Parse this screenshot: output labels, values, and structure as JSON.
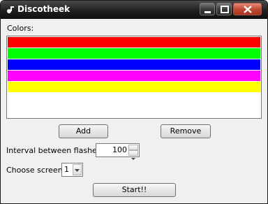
{
  "window": {
    "title": "Discotheek"
  },
  "colors_label": "Colors:",
  "colors": [
    {
      "name": "red",
      "hex": "#ff0000"
    },
    {
      "name": "green",
      "hex": "#00ff00"
    },
    {
      "name": "blue",
      "hex": "#0000ff"
    },
    {
      "name": "magenta",
      "hex": "#ff00ff"
    },
    {
      "name": "yellow",
      "hex": "#ffff00"
    },
    {
      "name": "white",
      "hex": "#ffffff"
    }
  ],
  "buttons": {
    "add": "Add",
    "remove": "Remove",
    "start": "Start!!"
  },
  "interval": {
    "label": "Interval between flashes:",
    "value": "100"
  },
  "screen": {
    "label": "Choose screen:",
    "value": "1"
  },
  "icons": {
    "app": "disco-icon",
    "minimize": "minimize-icon",
    "maximize": "maximize-icon",
    "close": "close-icon"
  }
}
